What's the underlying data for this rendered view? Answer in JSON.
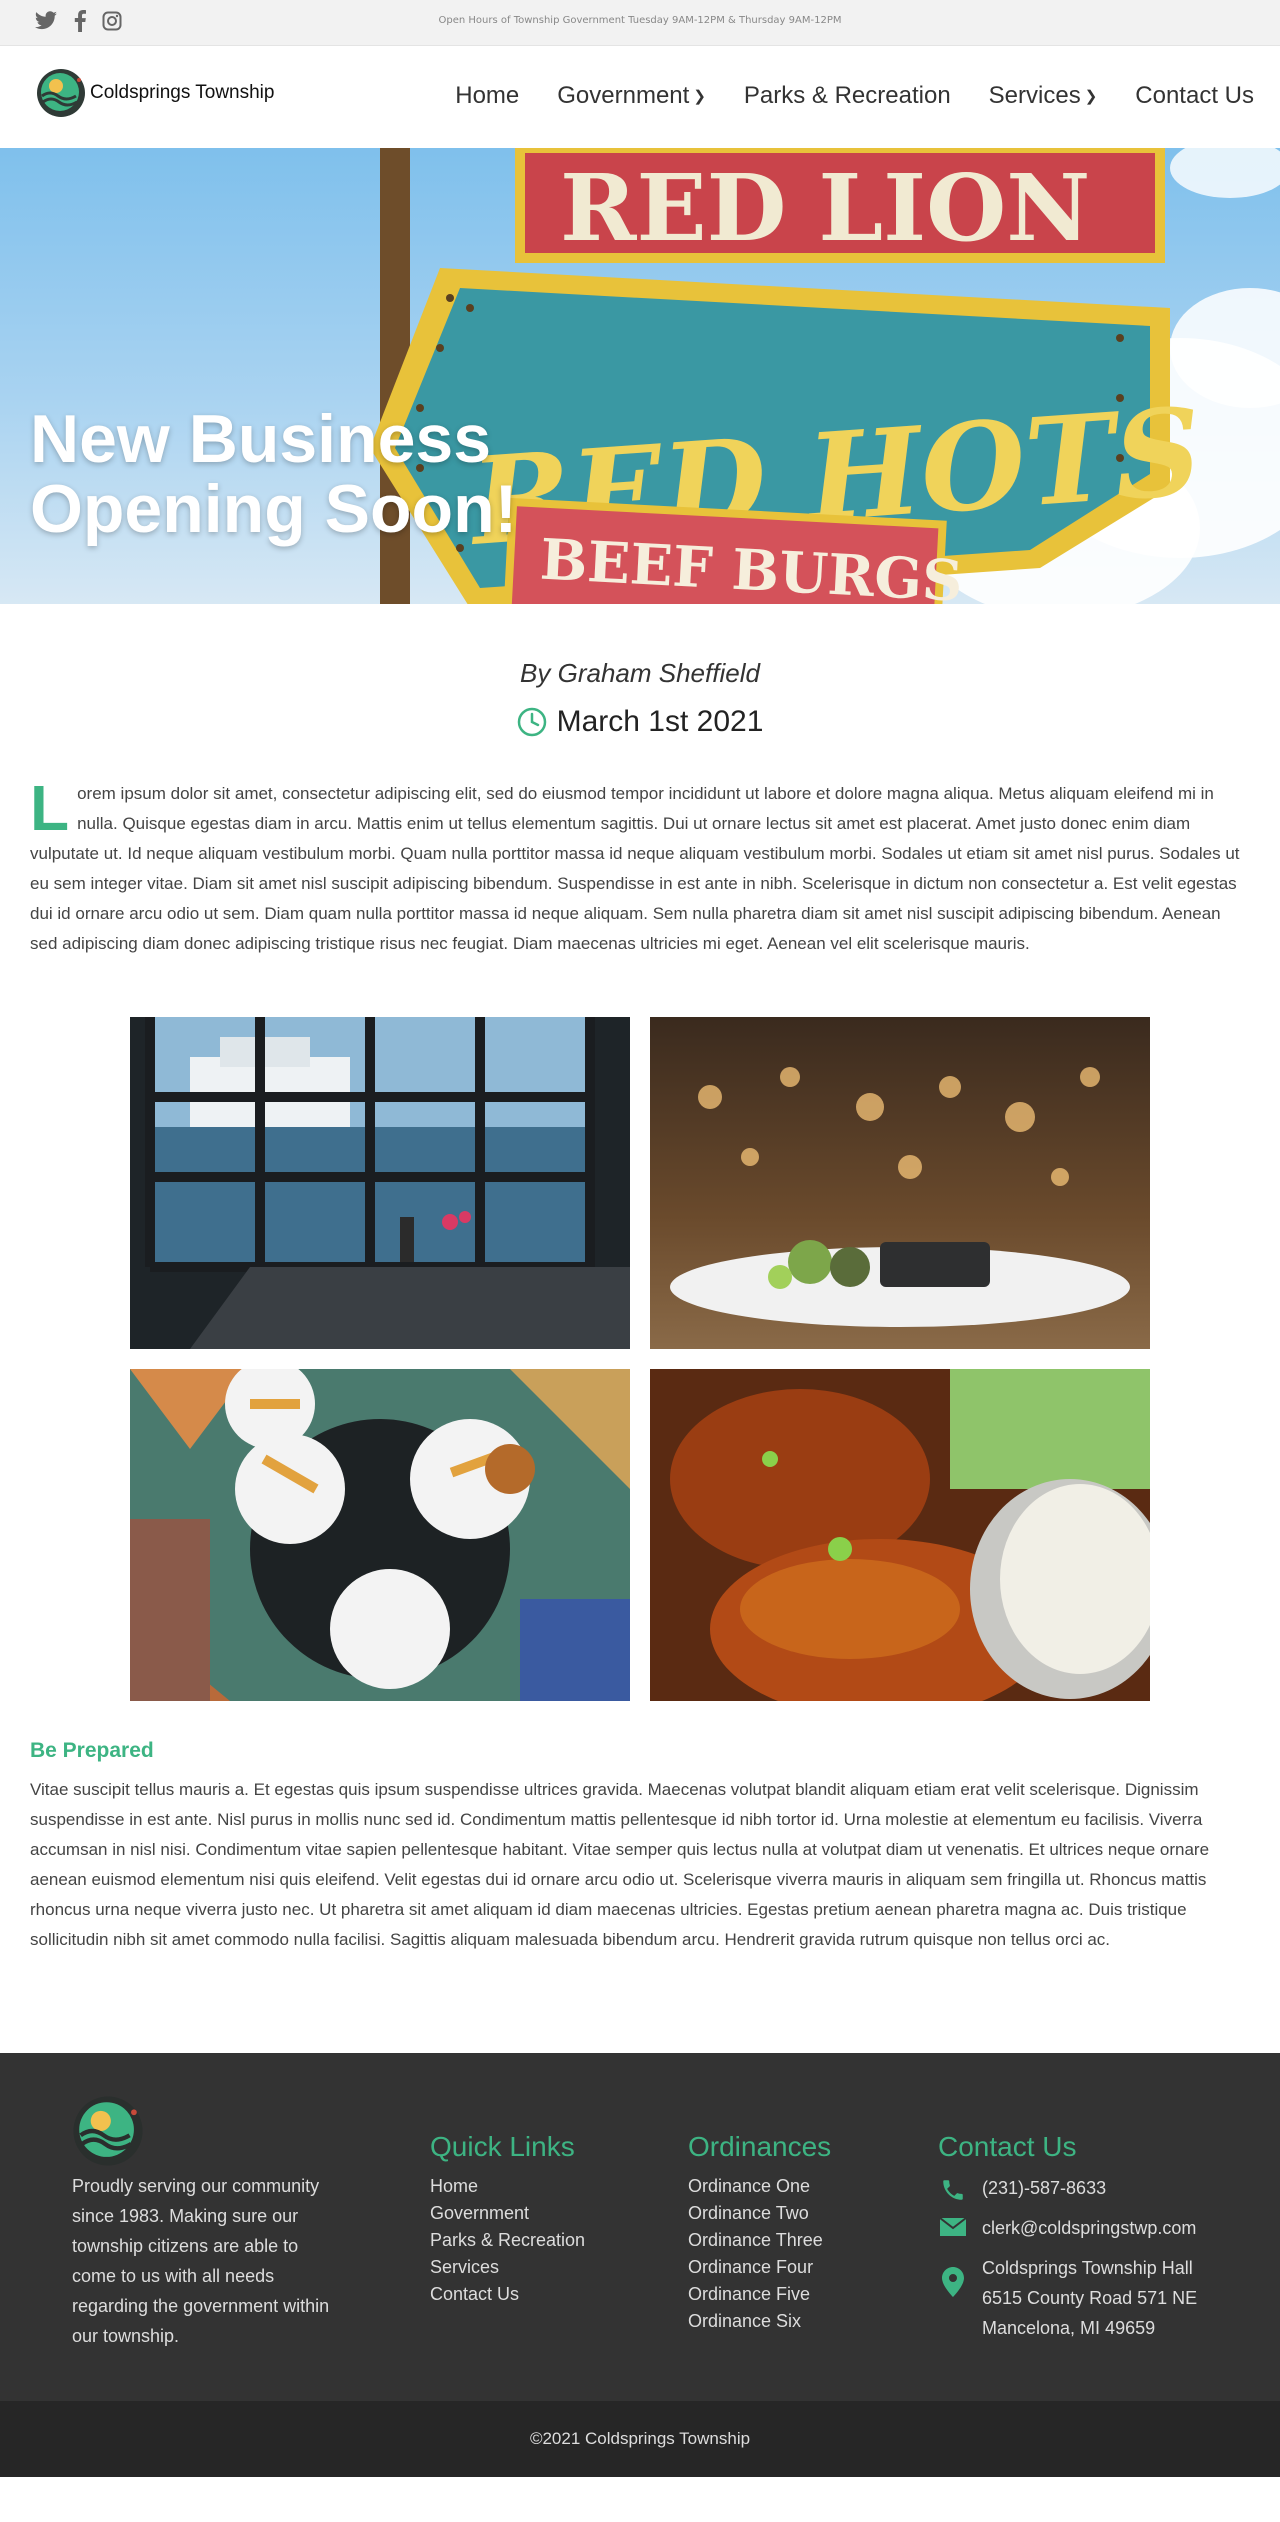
{
  "topbar": {
    "hours": "Open Hours of Township Government Tuesday 9AM-12PM & Thursday 9AM-12PM",
    "social_icons": [
      "twitter-icon",
      "facebook-icon",
      "instagram-icon"
    ]
  },
  "brand": {
    "name": "Coldsprings Township"
  },
  "nav": {
    "items": [
      {
        "label": "Home",
        "dropdown": false
      },
      {
        "label": "Government",
        "dropdown": true
      },
      {
        "label": "Parks & Recreation",
        "dropdown": false
      },
      {
        "label": "Services",
        "dropdown": true
      },
      {
        "label": "Contact Us",
        "dropdown": false
      }
    ]
  },
  "hero": {
    "title_line1": "New Business",
    "title_line2": "Opening Soon!",
    "sign_text": [
      "RED LION",
      "RED HOTS",
      "BEEF BURGS"
    ]
  },
  "article": {
    "byline": "By Graham Sheffield",
    "date": "March 1st 2021",
    "dropcap": "L",
    "intro": "orem ipsum dolor sit amet, consectetur adipiscing elit, sed do eiusmod tempor incididunt ut labore et dolore magna aliqua. Metus aliquam eleifend mi in nulla. Quisque egestas diam in arcu. Mattis enim ut tellus elementum sagittis. Dui ut ornare lectus sit amet est placerat. Amet justo donec enim diam vulputate ut. Id neque aliquam vestibulum morbi. Quam nulla porttitor massa id neque aliquam vestibulum morbi. Sodales ut etiam sit amet nisl purus. Sodales ut eu sem integer vitae. Diam sit amet nisl suscipit adipiscing bibendum. Suspendisse in est ante in nibh. Scelerisque in dictum non consectetur a. Est velit egestas dui id ornare arcu odio ut sem. Diam quam nulla porttitor massa id neque aliquam. Sem nulla pharetra diam sit amet nisl suscipit adipiscing bibendum. Aenean sed adipiscing diam donec adipiscing tristique risus nec feugiat. Diam maecenas ultricies mi eget. Aenean vel elit scelerisque mauris.",
    "section_title": "Be Prepared",
    "section_body": "Vitae suscipit tellus mauris a. Et egestas quis ipsum suspendisse ultrices gravida. Maecenas volutpat blandit aliquam etiam erat velit scelerisque. Dignissim suspendisse in est ante. Nisl purus in mollis nunc sed id. Condimentum mattis pellentesque id nibh tortor id. Urna molestie at elementum eu facilisis. Viverra accumsan in nisl nisi. Condimentum vitae sapien pellentesque habitant. Vitae semper quis lectus nulla at volutpat diam ut venenatis. Et ultrices neque ornare aenean euismod elementum nisi quis eleifend. Velit egestas dui id ornare arcu odio ut. Scelerisque viverra mauris in aliquam sem fringilla ut. Rhoncus mattis rhoncus urna neque viverra justo nec. Ut pharetra sit amet aliquam id diam maecenas ultricies. Egestas pretium aenean pharetra magna ac. Duis tristique sollicitudin nibh sit amet commodo nulla facilisi. Sagittis aliquam malesuada bibendum arcu. Hendrerit gravida rutrum quisque non tellus orci ac."
  },
  "footer": {
    "about": "Proudly serving our community since 1983. Making sure our township citizens are able to come to us with all needs regarding the government within our township.",
    "quick_links": {
      "title": "Quick Links",
      "items": [
        "Home",
        "Government",
        "Parks & Recreation",
        "Services",
        "Contact Us"
      ]
    },
    "ordinances": {
      "title": "Ordinances",
      "items": [
        "Ordinance One",
        "Ordinance Two",
        "Ordinance Three",
        "Ordinance Four",
        "Ordinance Five",
        "Ordinance Six"
      ]
    },
    "contact": {
      "title": "Contact Us",
      "phone": "(231)-587-8633",
      "email": "clerk@coldspringstwp.com",
      "address_line1": "Coldsprings Township Hall",
      "address_line2": "6515 County Road 571 NE",
      "address_line3": "Mancelona, MI 49659"
    },
    "copyright": "©2021 Coldsprings Township"
  },
  "colors": {
    "accent": "#3db483",
    "footer_bg": "#333333",
    "copyright_bg": "#262626"
  }
}
